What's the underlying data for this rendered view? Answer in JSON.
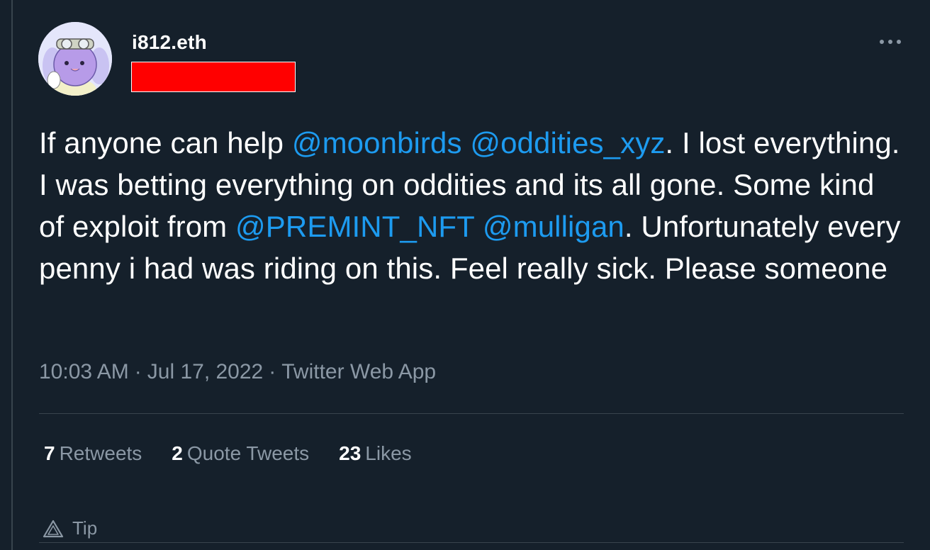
{
  "author": {
    "display_name": "i812.eth",
    "avatar_icon": "cartoon-bird-avatar-icon"
  },
  "menu": {
    "more_icon": "ellipsis-icon"
  },
  "tweet": {
    "segments": [
      {
        "text": "If anyone can help ",
        "type": "text"
      },
      {
        "text": "@moonbirds",
        "type": "mention"
      },
      {
        "text": " ",
        "type": "text"
      },
      {
        "text": "@oddities_xyz",
        "type": "mention"
      },
      {
        "text": ". I lost everything. I was betting everything on oddities and its all gone. Some kind of exploit from ",
        "type": "text"
      },
      {
        "text": "@PREMINT_NFT",
        "type": "mention"
      },
      {
        "text": " ",
        "type": "text"
      },
      {
        "text": "@mulligan",
        "type": "mention"
      },
      {
        "text": ". Unfortunately every penny i had was riding on this. Feel really sick. Please someone",
        "type": "text"
      }
    ]
  },
  "meta": {
    "time": "10:03 AM",
    "separator": "·",
    "date": "Jul 17, 2022",
    "source": "Twitter Web App"
  },
  "stats": {
    "retweets_count": "7",
    "retweets_label": "Retweets",
    "quotes_count": "2",
    "quotes_label": "Quote Tweets",
    "likes_count": "23",
    "likes_label": "Likes"
  },
  "tip": {
    "label": "Tip",
    "icon": "tip-triangle-icon"
  },
  "colors": {
    "background": "#15202b",
    "mention": "#1d9bf0",
    "muted": "#8b98a5",
    "redaction": "#ff0000"
  }
}
